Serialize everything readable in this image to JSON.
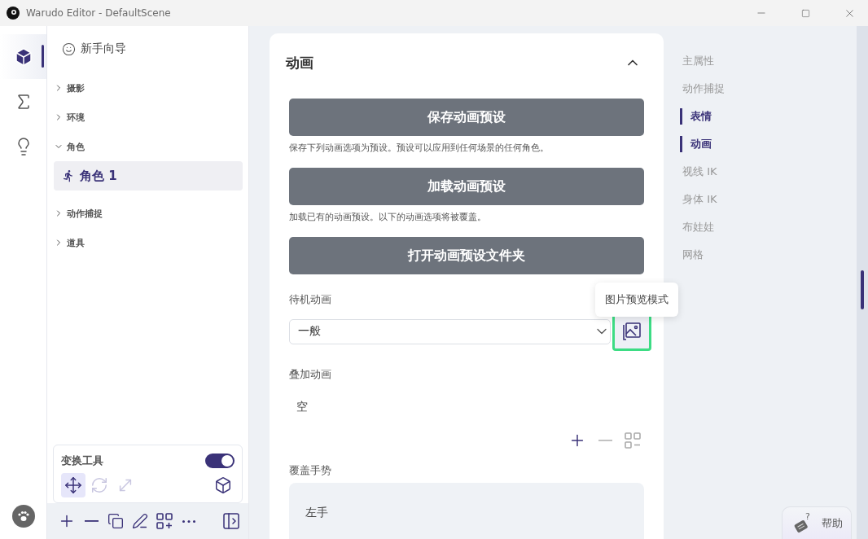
{
  "window": {
    "title": "Warudo Editor - DefaultScene"
  },
  "rail": [
    {
      "selected": true
    },
    {
      "selected": false
    },
    {
      "selected": false
    }
  ],
  "scene_tree": {
    "guide": "新手向导",
    "items": [
      {
        "label": "摄影",
        "expanded": false
      },
      {
        "label": "环境",
        "expanded": false
      },
      {
        "label": "角色",
        "expanded": true,
        "children": [
          {
            "label": "角色 1",
            "selected": true
          }
        ]
      },
      {
        "label": "动作捕捉",
        "expanded": false
      },
      {
        "label": "道具",
        "expanded": false
      }
    ]
  },
  "transform_tool": {
    "title": "变换工具",
    "on": true,
    "tools": [
      {
        "selected": true,
        "disabled": false
      },
      {
        "selected": false,
        "disabled": true
      },
      {
        "selected": false,
        "disabled": true
      }
    ]
  },
  "section": {
    "title": "动画",
    "expanded": true,
    "presets": [
      {
        "label": "保存动画预设",
        "description": "保存下列动画选项为预设。预设可以应用到任何场景的任何角色。"
      },
      {
        "label": "加载动画预设",
        "description": "加载已有的动画预设。以下的动画选项将被覆盖。"
      },
      {
        "label": "打开动画预设文件夹"
      }
    ],
    "idle_animation": {
      "label": "待机动画",
      "value": "一般",
      "tooltip": "图片预览模式"
    },
    "overlay_animations": {
      "label": "叠加动画",
      "empty_text": "空"
    },
    "override_gestures": {
      "label": "覆盖手势",
      "items": [
        "左手"
      ]
    }
  },
  "nav": [
    {
      "label": "主属性",
      "selected": false
    },
    {
      "label": "动作捕捉",
      "selected": false
    },
    {
      "label": "表情",
      "selected": true
    },
    {
      "label": "动画",
      "selected": true
    },
    {
      "label": "视线 IK",
      "selected": false
    },
    {
      "label": "身体 IK",
      "selected": false
    },
    {
      "label": "布娃娃",
      "selected": false
    },
    {
      "label": "网格",
      "selected": false
    }
  ],
  "help_button": "帮助",
  "help_icon_mark": "?"
}
